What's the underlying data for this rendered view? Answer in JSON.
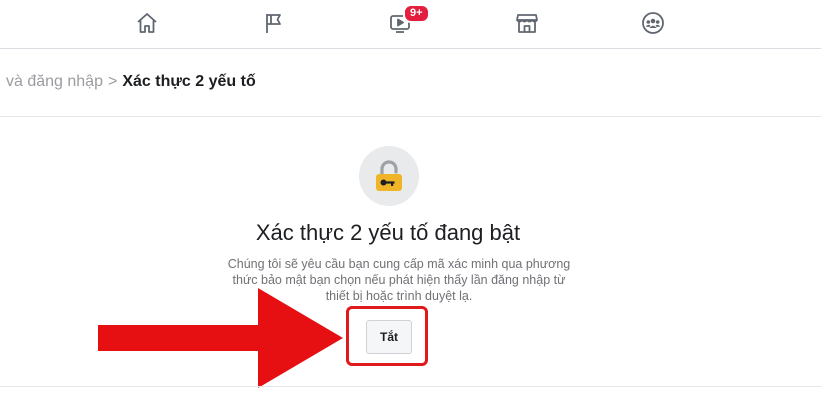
{
  "nav": {
    "items": [
      {
        "icon": "home-icon"
      },
      {
        "icon": "flag-icon"
      },
      {
        "icon": "video-icon",
        "badge": "9+"
      },
      {
        "icon": "marketplace-icon"
      },
      {
        "icon": "groups-icon"
      }
    ]
  },
  "breadcrumb": {
    "parent": "và đăng nhập",
    "separator": ">",
    "current": "Xác thực 2 yếu tố"
  },
  "status": {
    "icon": "lock-key-icon",
    "title": "Xác thực 2 yếu tố đang bật",
    "description": "Chúng tôi sẽ yêu cầu bạn cung cấp mã xác minh qua phương thức bảo mật bạn chọn nếu phát hiện thấy lần đăng nhập từ thiết bị hoặc trình duyệt lạ.",
    "button_label": "Tắt"
  },
  "colors": {
    "badge": "#e41e3f",
    "annotation": "#e0191b",
    "lock": "#f0b429"
  }
}
